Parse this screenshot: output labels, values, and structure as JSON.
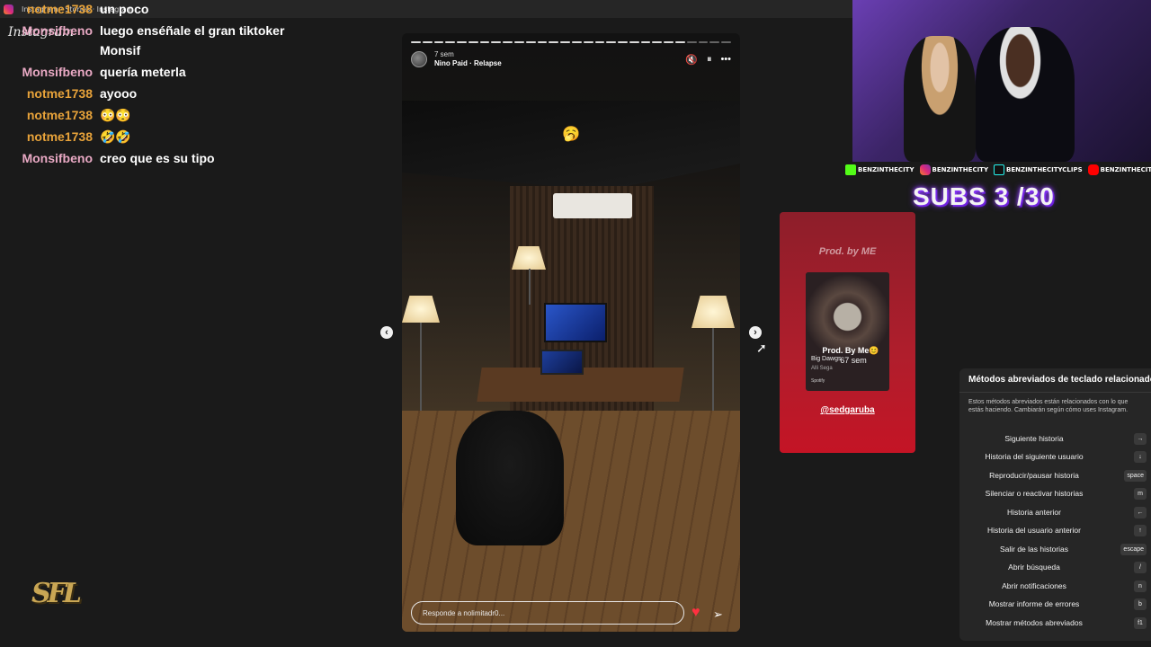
{
  "browser": {
    "tab_title": "Instagram · Stories · Instagram"
  },
  "app": {
    "logo": "Instagram"
  },
  "chat": [
    {
      "user": "notme1738",
      "text": "un poco",
      "color": "orange"
    },
    {
      "user": "Monsifbeno",
      "text": "luego enséñale el gran tiktoker Monsif",
      "color": "pink"
    },
    {
      "user": "Monsifbeno",
      "text": "quería meterla",
      "color": "pink"
    },
    {
      "user": "notme1738",
      "text": "ayooo",
      "color": "orange"
    },
    {
      "user": "notme1738",
      "text": "😳😳",
      "color": "orange"
    },
    {
      "user": "notme1738",
      "text": "🤣🤣",
      "color": "orange"
    },
    {
      "user": "Monsifbeno",
      "text": "creo que es su tipo",
      "color": "pink"
    }
  ],
  "story": {
    "time": "7 sem",
    "song": "Nino Paid · Relapse",
    "sticker": "🥱",
    "reply_placeholder": "Responde a nolimitadr0...",
    "mute_icon": "🔇",
    "pause_icon": "⏸",
    "more_icon": "•••",
    "heart_icon": "♥",
    "send_icon": "➢",
    "prev_icon": "‹",
    "next_icon": "›"
  },
  "next_story": {
    "title": "Prod. by ME",
    "album_name": "Big Dawgs",
    "album_artist": "Alli Sega",
    "album_badge": "Spotify",
    "username": "Prod. By Me😊",
    "time": "67 sem",
    "mention": "@sedgaruba"
  },
  "stream": {
    "socials": [
      {
        "handle": "BENZINTHECITY",
        "icon": "kick-icon"
      },
      {
        "handle": "BENZINTHECITY",
        "icon": "instagram-icon"
      },
      {
        "handle": "BENZINTHECITYCLIPS",
        "icon": "tiktok-icon"
      },
      {
        "handle": "BENZINTHECITYLIVE",
        "icon": "youtube-icon"
      }
    ],
    "subs_goal": "SUBS 3 /30",
    "logo": "SFL"
  },
  "shortcuts": {
    "title": "Métodos abreviados de teclado relacionados",
    "description": "Estos métodos abreviados están relacionados con lo que estás haciendo. Cambiarán según cómo uses Instagram.",
    "items": [
      {
        "label": "Siguiente historia",
        "key": "→"
      },
      {
        "label": "Historia del siguiente usuario",
        "key": "↓"
      },
      {
        "label": "Reproducir/pausar historia",
        "key": "space"
      },
      {
        "label": "Silenciar o reactivar historias",
        "key": "m"
      },
      {
        "label": "Historia anterior",
        "key": "←"
      },
      {
        "label": "Historia del usuario anterior",
        "key": "↑"
      },
      {
        "label": "Salir de las historias",
        "key": "escape"
      },
      {
        "label": "Abrir búsqueda",
        "key": "/"
      },
      {
        "label": "Abrir notificaciones",
        "key": "n"
      },
      {
        "label": "Mostrar informe de errores",
        "key": "b"
      },
      {
        "label": "Mostrar métodos abreviados",
        "key": "f1"
      }
    ]
  },
  "colors": {
    "accent_red": "#ff3040",
    "user_orange": "#e8a33a",
    "user_pink": "#e9a9c4",
    "next_story_bg": "#b01e2c"
  }
}
